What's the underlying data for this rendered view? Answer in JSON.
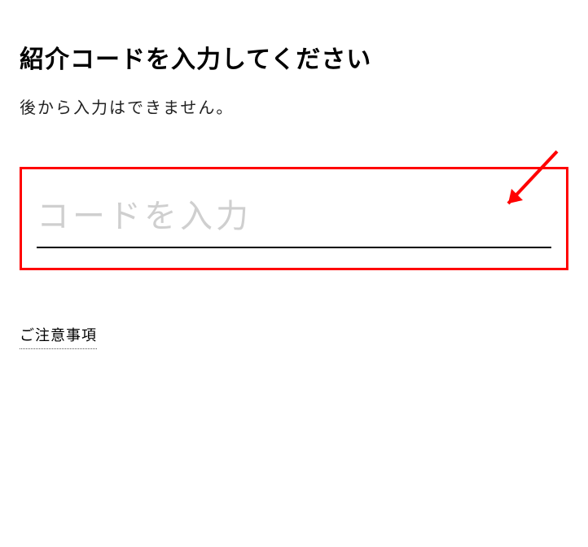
{
  "heading": "紹介コードを入力してください",
  "subtext": "後から入力はできません。",
  "input": {
    "placeholder": "コードを入力"
  },
  "notice_link": "ご注意事項",
  "annotation": {
    "arrow_color": "#ff0000",
    "highlight_border_color": "#ff0000"
  }
}
